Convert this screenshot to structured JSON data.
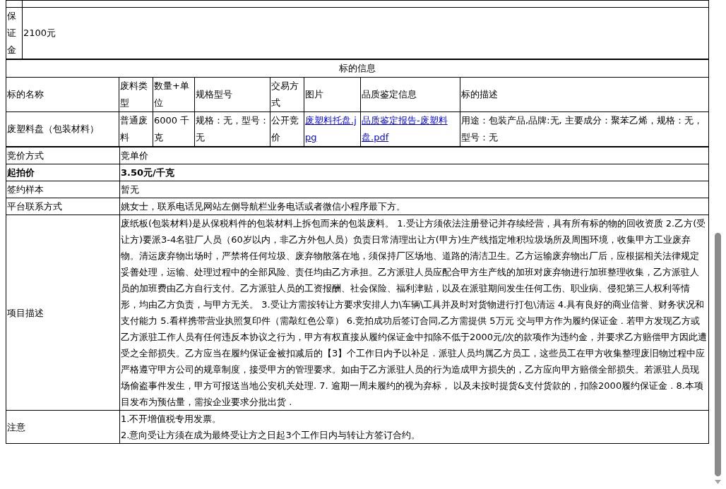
{
  "deposit": {
    "label": "保证金",
    "value": "2100元"
  },
  "lot_info": {
    "title": "标的信息",
    "columns": [
      "标的名称",
      "废料类型",
      "数量+单位",
      "规格型号",
      "交易方式",
      "图片",
      "品质鉴定信息",
      "标的描述"
    ],
    "rows": [
      {
        "cells": [
          {
            "kind": "text",
            "text": "废塑料盘（包装材料）"
          },
          {
            "kind": "text",
            "text": "普通废料"
          },
          {
            "kind": "text",
            "text": "6000 千克"
          },
          {
            "kind": "text",
            "text": "规格：无，型号：无"
          },
          {
            "kind": "text",
            "text": "公开竞价"
          },
          {
            "kind": "link",
            "text": "废塑料托盘.jpg"
          },
          {
            "kind": "link",
            "text": "品质鉴定报告-废塑料盘.pdf"
          },
          {
            "kind": "text",
            "text": "用途：包装产品,品牌:无, 主要成分：聚苯乙烯，规格：无，型号：无"
          }
        ]
      }
    ]
  },
  "details": [
    {
      "label": "竞价方式",
      "kind": "text",
      "bold": false,
      "value": "竞单价"
    },
    {
      "label": "起拍价",
      "kind": "text",
      "bold": true,
      "value": "3.50元/千克"
    },
    {
      "label": "签约样本",
      "kind": "text",
      "bold": false,
      "value": "暂无"
    },
    {
      "label": "平台联系方式",
      "kind": "text",
      "bold": false,
      "value": "姚女士，联系电话见网站左侧导航栏业务电话或者微信小程序最下方。"
    },
    {
      "label": "项目描述",
      "kind": "text",
      "bold": false,
      "value": "废纸板(包装材料)是从保税料件的包装材料上拆包而来的包装废料。 1.受让方须依法注册登记并存续经营，具有所有标的物的回收资质 2.乙方(受让方)要派3-4名驻厂人员（60岁以内，非乙方外包人员）负责日常清理出让方(甲方)生产线指定堆积垃圾场所及周围环境，收集甲方工业废弃物。清运废弃物出场时，严禁将任何垃圾、废弃物散落在地，须保持厂区场地、道路的清洁卫生。乙方运输废弃物出厂后，应根据相关法律规定妥善处理，运输、处理过程中的全部风险、责任均由乙方承担。乙方派驻人员应配合甲方生产线的加班对废弃物进行加班整理收集，乙方派驻人员的加班费由乙方自行支付。乙方派驻人员的工资报酬、社会保险、福利津贴，以及在派驻期间发生任何工伤、职业病、侵犯第三人权利等情形，均由乙方负责，与甲方无关。 3.受让方需按转让方要求安排人力\\车辆\\工具并及时对货物进行打包\\清运 4.具有良好的商业信誉、财务状况和支付能力 5.看样携带营业执照复印件（需敲红色公章） 6.竞拍成功后签订合同,乙方需提供 5万元 交与甲方作为履约保证金 . 若甲方发现乙方或乙方派驻工作人员有任何违反本协议之行为，甲方有权直接从履约保证金中扣除不低于2000元/次的款项作为违约金，并要求乙方赔偿甲方因此遭受之全部损失。乙方应当在履约保证金被扣减后的【3】个工作日内予以补足 . 派驻人员均属乙方员工，这些员工在甲方收集整理废旧物过程中应严格遵守甲方公司的规章制度，接受甲方的管理要求。如由于乙方派驻人员的行为造成甲方损失的，乙方应向甲方赔偿全部损失。若派驻人员现场偷盗事件发生，甲方可报送当地公安机关处理. 7. 逾期一周未履约的视为弃标， 以及未按时提货&支付货款的，扣除2000履约保证金 . 8.本项目发布为预估量，需按企业要求分批出货 ."
    },
    {
      "label": "注意",
      "kind": "lines",
      "bold": false,
      "lines": [
        "1.不开增值税专用发票。",
        "2.意向受让方须在成为最终受让方之日起3个工作日内与转让方签订合约。"
      ]
    }
  ]
}
